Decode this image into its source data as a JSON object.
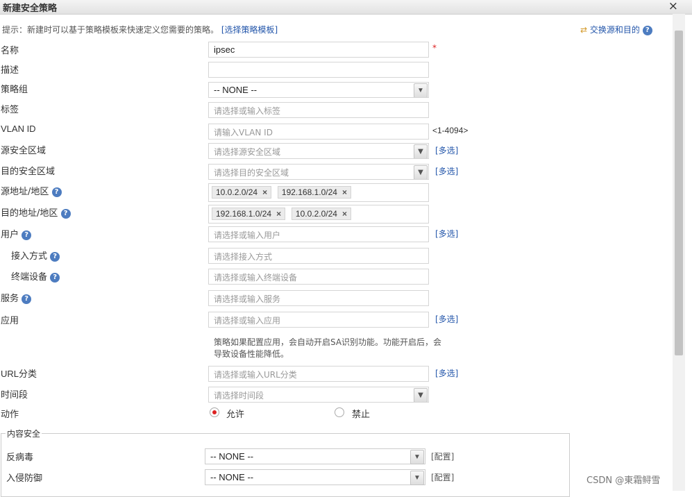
{
  "dialog": {
    "title": "新建安全策略",
    "close": "×",
    "hint_text": "提示：新建时可以基于策略模板来快速定义您需要的策略。",
    "template_link": "[选择策略模板]",
    "swap_text": "交换源和目的"
  },
  "labels": {
    "name": "名称",
    "desc": "描述",
    "group": "策略组",
    "tag": "标签",
    "vlan": "VLAN ID",
    "src_zone": "源安全区域",
    "dst_zone": "目的安全区域",
    "src_addr": "源地址/地区",
    "dst_addr": "目的地址/地区",
    "user": "用户",
    "access": "接入方式",
    "terminal": "终端设备",
    "service": "服务",
    "app": "应用",
    "url": "URL分类",
    "time": "时间段",
    "action": "动作"
  },
  "fields": {
    "name_value": "ipsec",
    "group_value": "-- NONE --",
    "tag_placeholder": "请选择或输入标签",
    "vlan_placeholder": "请输入VLAN ID",
    "vlan_range": "<1-4094>",
    "src_zone_placeholder": "请选择源安全区域",
    "dst_zone_placeholder": "请选择目的安全区域",
    "user_placeholder": "请选择或输入用户",
    "access_placeholder": "请选择接入方式",
    "terminal_placeholder": "请选择或输入终端设备",
    "service_placeholder": "请选择或输入服务",
    "app_placeholder": "请选择或输入应用",
    "url_placeholder": "请选择或输入URL分类",
    "time_placeholder": "请选择时间段"
  },
  "src_addr_tags": [
    "10.0.2.0/24",
    "192.168.1.0/24"
  ],
  "dst_addr_tags": [
    "192.168.1.0/24",
    "10.0.2.0/24"
  ],
  "multi_select": "[多选]",
  "required_mark": "*",
  "app_note": "策略如果配置应用，会自动开启SA识别功能。功能开启后，会导致设备性能降低。",
  "action": {
    "allow": "允许",
    "deny": "禁止",
    "selected": "allow"
  },
  "content_security": {
    "title": "内容安全",
    "antivirus_label": "反病毒",
    "antivirus_value": "-- NONE --",
    "ips_label": "入侵防御",
    "ips_value": "-- NONE --",
    "config": "[配置]"
  },
  "watermark": "CSDN @東霜鲟雪",
  "icons": {
    "help": "?",
    "dropdown": "chevron-down",
    "swap": "swap-arrows"
  }
}
